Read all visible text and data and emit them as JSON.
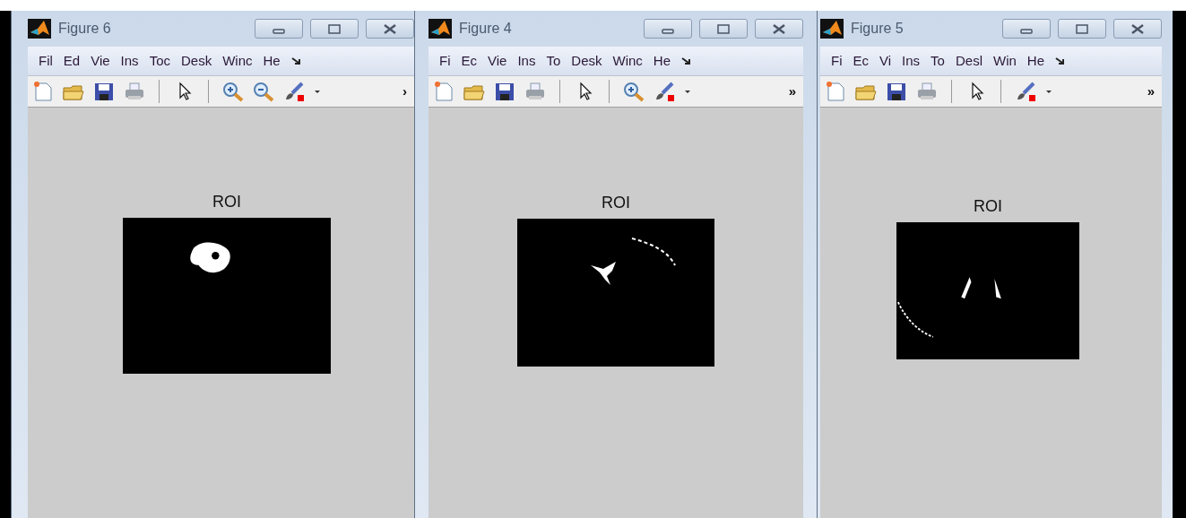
{
  "windows": [
    {
      "title": "Figure 6",
      "menu": [
        "Fil",
        "Ed",
        "Vie",
        "Ins",
        "Toc",
        "Desk",
        "Winc",
        "He"
      ],
      "tools": [
        {
          "kind": "new"
        },
        {
          "kind": "open"
        },
        {
          "kind": "save"
        },
        {
          "kind": "print"
        },
        {
          "kind": "separator"
        },
        {
          "kind": "pointer"
        },
        {
          "kind": "separator"
        },
        {
          "kind": "zoom-in"
        },
        {
          "kind": "zoom-out"
        },
        {
          "kind": "brush"
        },
        {
          "kind": "dropdown"
        }
      ],
      "more": "›",
      "plot": {
        "title": "ROI"
      }
    },
    {
      "title": "Figure 4",
      "menu": [
        "Fi",
        "Ec",
        "Vie",
        "Ins",
        "To",
        "Desk",
        "Winc",
        "He"
      ],
      "tools": [
        {
          "kind": "new"
        },
        {
          "kind": "open"
        },
        {
          "kind": "save"
        },
        {
          "kind": "print"
        },
        {
          "kind": "separator"
        },
        {
          "kind": "pointer"
        },
        {
          "kind": "separator"
        },
        {
          "kind": "zoom-in"
        },
        {
          "kind": "brush"
        },
        {
          "kind": "dropdown"
        }
      ],
      "more": "»",
      "plot": {
        "title": "ROI"
      }
    },
    {
      "title": "Figure 5",
      "menu": [
        "Fi",
        "Ec",
        "Vi",
        "Ins",
        "To",
        "Desl",
        "Win",
        "He"
      ],
      "tools": [
        {
          "kind": "new"
        },
        {
          "kind": "open"
        },
        {
          "kind": "save"
        },
        {
          "kind": "print"
        },
        {
          "kind": "separator"
        },
        {
          "kind": "pointer"
        },
        {
          "kind": "separator"
        },
        {
          "kind": "brush"
        },
        {
          "kind": "dropdown"
        }
      ],
      "more": "»",
      "plot": {
        "title": "ROI"
      }
    }
  ]
}
